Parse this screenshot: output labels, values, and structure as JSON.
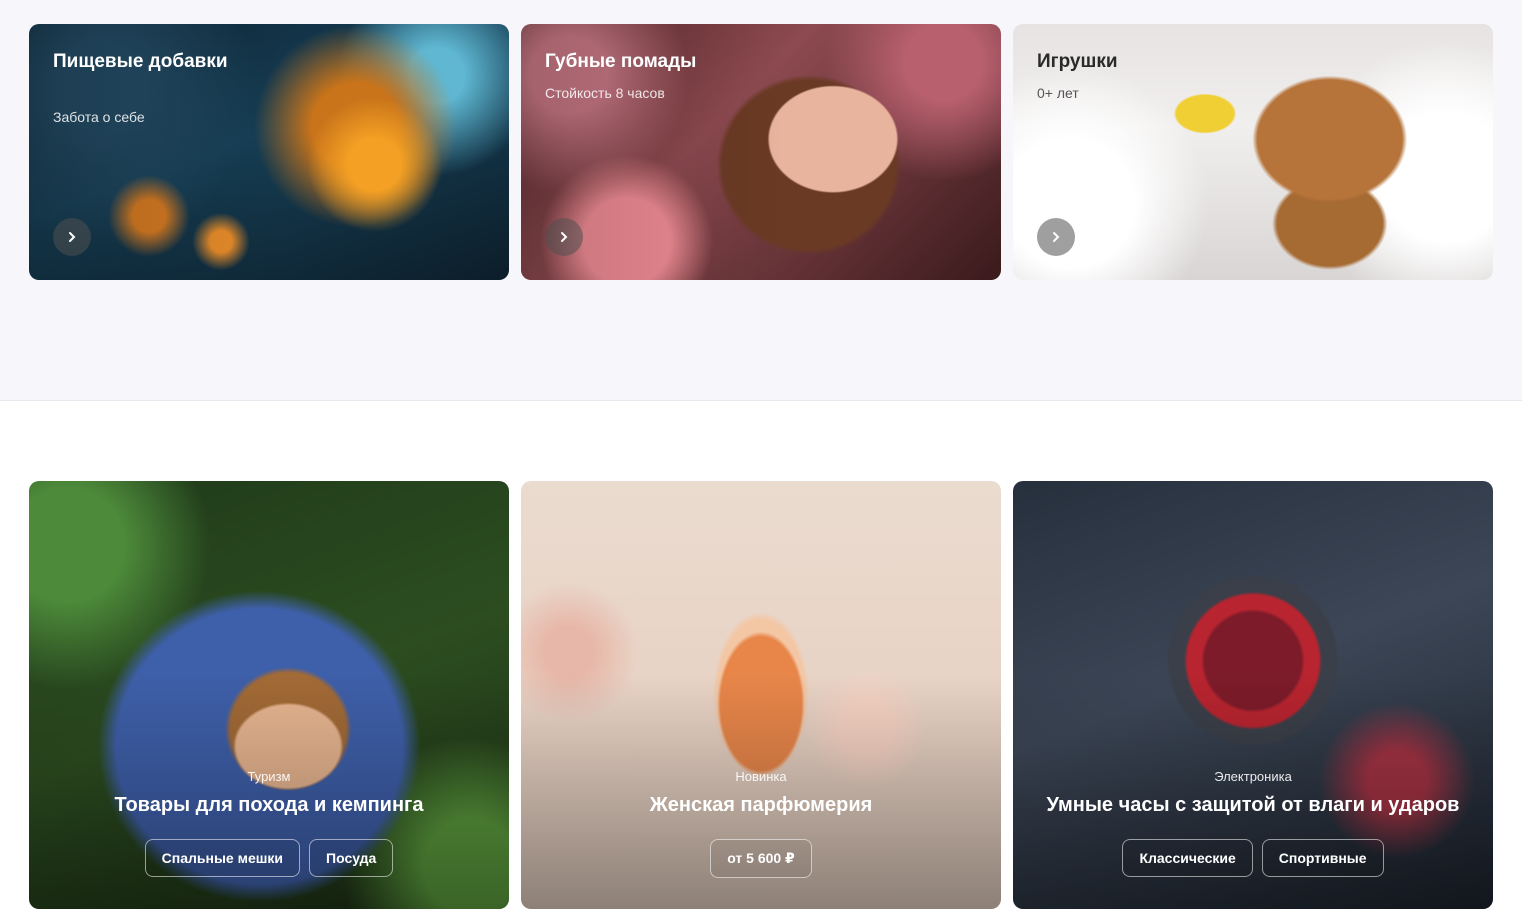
{
  "top_categories": [
    {
      "title": "Пищевые добавки",
      "subtitle": "Забота о себе"
    },
    {
      "title": "Губные помады",
      "subtitle": "Стойкость 8 часов"
    },
    {
      "title": "Игрушки",
      "subtitle": "0+ лет"
    }
  ],
  "featured": [
    {
      "eyebrow": "Туризм",
      "title": "Товары для похода и кемпинга",
      "tags": [
        "Спальные мешки",
        "Посуда"
      ]
    },
    {
      "eyebrow": "Новинка",
      "title": "Женская парфюмерия",
      "tags": [
        "от 5 600 ₽"
      ]
    },
    {
      "eyebrow": "Электроника",
      "title": "Умные часы с защитой от влаги и ударов",
      "tags": [
        "Классические",
        "Спортивные"
      ]
    }
  ],
  "icons": {
    "arrow": "chevron-right-icon"
  }
}
